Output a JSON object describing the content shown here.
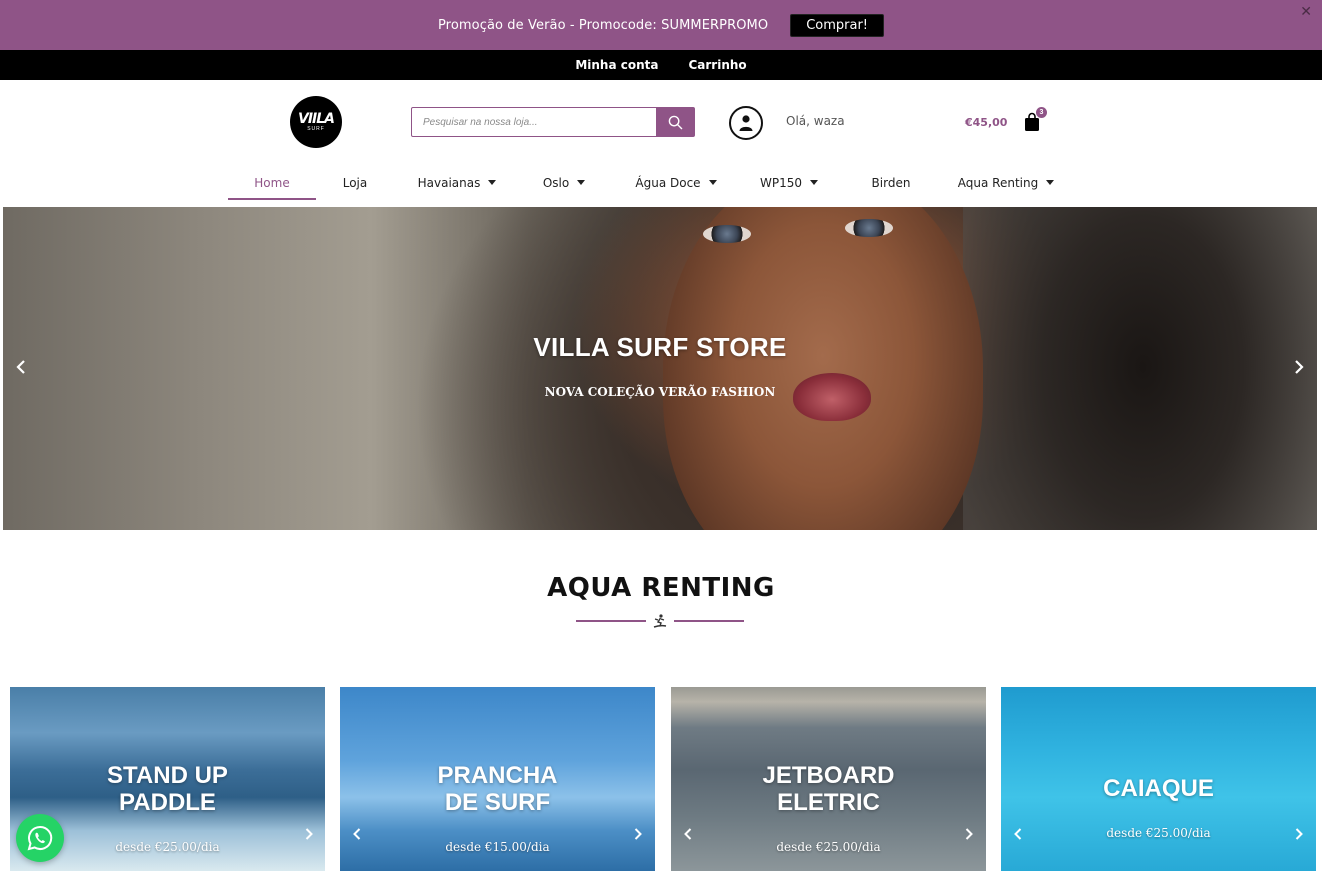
{
  "promo": {
    "text": "Promoção de Verão - Promocode: SUMMERPROMO",
    "button_label": "Comprar!",
    "close_label": "✕"
  },
  "topnav": {
    "items": [
      {
        "label": "Minha conta"
      },
      {
        "label": "Carrinho"
      }
    ]
  },
  "header": {
    "logo_text": "VIILA",
    "logo_subtext": "SURF",
    "search_placeholder": "Pesquisar na nossa loja...",
    "greeting": "Olá, waza",
    "cart_total": "€45,00",
    "cart_count": "3"
  },
  "nav": {
    "items": [
      {
        "label": "Home",
        "active": true,
        "dropdown": false
      },
      {
        "label": "Loja",
        "active": false,
        "dropdown": false
      },
      {
        "label": "Havaianas",
        "active": false,
        "dropdown": true
      },
      {
        "label": "Oslo",
        "active": false,
        "dropdown": true
      },
      {
        "label": "Água Doce",
        "active": false,
        "dropdown": true
      },
      {
        "label": "WP150",
        "active": false,
        "dropdown": true
      },
      {
        "label": "Birden",
        "active": false,
        "dropdown": false
      },
      {
        "label": "Aqua Renting",
        "active": false,
        "dropdown": true
      }
    ]
  },
  "hero": {
    "title": "VILLA SURF STORE",
    "subtitle": "NOVA COLEÇÃO VERÃO FASHION"
  },
  "section": {
    "title": "AQUA RENTING"
  },
  "cards": [
    {
      "title_line1": "STAND UP",
      "title_line2": "PADDLE",
      "price": "desde €25.00/dia"
    },
    {
      "title_line1": "PRANCHA",
      "title_line2": "DE SURF",
      "price": "desde €15.00/dia"
    },
    {
      "title_line1": "JETBOARD",
      "title_line2": "ELETRIC",
      "price": "desde €25.00/dia"
    },
    {
      "title_line1": "CAIAQUE",
      "title_line2": "",
      "price": "desde €25.00/dia"
    }
  ],
  "colors": {
    "brand": "#8f5487",
    "topbar": "#000000",
    "whatsapp": "#25d366"
  }
}
